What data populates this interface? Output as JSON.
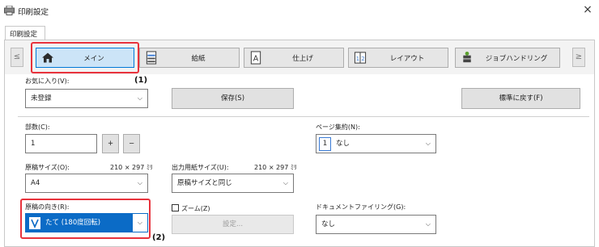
{
  "window": {
    "title": "印刷設定",
    "close": "×"
  },
  "dialog_tab": "印刷設定",
  "nav": {
    "prev": "≤",
    "next": "≥"
  },
  "tabs": [
    {
      "id": "main",
      "label": "メイン",
      "icon": "home-icon",
      "active": true
    },
    {
      "id": "paper",
      "label": "給紙",
      "icon": "paper-tray-icon",
      "active": false
    },
    {
      "id": "finishing",
      "label": "仕上げ",
      "icon": "finishing-icon",
      "active": false
    },
    {
      "id": "layout",
      "label": "レイアウト",
      "icon": "layout-icon",
      "active": false
    },
    {
      "id": "job",
      "label": "ジョブハンドリング",
      "icon": "job-handling-icon",
      "active": false
    }
  ],
  "favorites": {
    "label": "お気に入り(V):",
    "value": "未登録",
    "save_button": "保存(S)",
    "reset_button": "標準に戻す(F)"
  },
  "copies": {
    "label": "部数(C):",
    "value": "1",
    "plus": "+",
    "minus": "−"
  },
  "pages_per_sheet": {
    "label": "ページ集約(N):",
    "icon_text": "1",
    "value": "なし"
  },
  "original_size": {
    "label": "原稿サイズ(O):",
    "dims": "210 × 297 ﾐﾘ",
    "value": "A4"
  },
  "output_size": {
    "label": "出力用紙サイズ(U):",
    "dims": "210 × 297 ﾐﾘ",
    "value": "原稿サイズと同じ"
  },
  "orientation": {
    "label": "原稿の向き(R):",
    "value": "たて (180度回転)"
  },
  "zoom": {
    "label": "ズーム(Z)",
    "checked": false,
    "settings_button": "設定..."
  },
  "document_filing": {
    "label": "ドキュメントファイリング(G):",
    "value": "なし"
  },
  "callouts": {
    "one": "(1)",
    "two": "(2)"
  },
  "colors": {
    "accent": "#0078d7",
    "highlight": "#e8323c",
    "selected": "#0b6bc6"
  }
}
